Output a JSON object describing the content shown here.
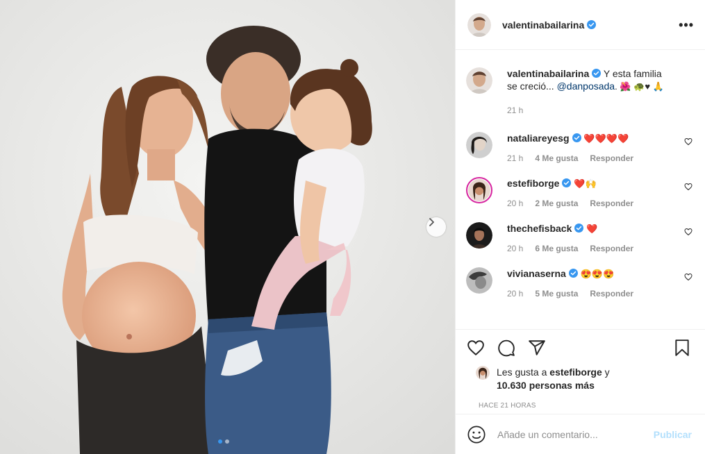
{
  "post": {
    "author": "valentinabailarina",
    "more_icon": "more-horizontal-icon",
    "image": {
      "description_icon": "family-photo",
      "carousel_dots": 2,
      "active_dot": 1,
      "next_icon": "chevron-right-icon"
    }
  },
  "caption": {
    "username": "valentinabailarina",
    "text": " Y esta familia se creció... ",
    "mention": "@danposada",
    "suffix": ". 🌺 🐢♥ 🙏",
    "time": "21 h"
  },
  "comments": [
    {
      "username": "nataliareyesg",
      "verified": true,
      "text": "❤️❤️❤️❤️",
      "time": "21 h",
      "likes": "4 Me gusta",
      "reply": "Responder"
    },
    {
      "username": "estefiborge",
      "verified": true,
      "text": "❤️🙌",
      "time": "20 h",
      "likes": "2 Me gusta",
      "reply": "Responder"
    },
    {
      "username": "thechefisback",
      "verified": true,
      "text": "❤️",
      "time": "20 h",
      "likes": "6 Me gusta",
      "reply": "Responder"
    },
    {
      "username": "vivianaserna",
      "verified": true,
      "text": "😍😍😍",
      "time": "20 h",
      "likes": "5 Me gusta",
      "reply": "Responder"
    }
  ],
  "likes": {
    "prefix": "Les gusta a ",
    "user": "estefiborge",
    "connector": " y",
    "others": "10.630 personas más"
  },
  "time_ago": "HACE 21 HORAS",
  "add_comment": {
    "placeholder": "Añade un comentario...",
    "publish": "Publicar"
  },
  "colors": {
    "verified": "#3897f0",
    "link": "#00376b",
    "publish_disabled": "#b2dffc",
    "secondary_text": "#8e8e8e"
  }
}
